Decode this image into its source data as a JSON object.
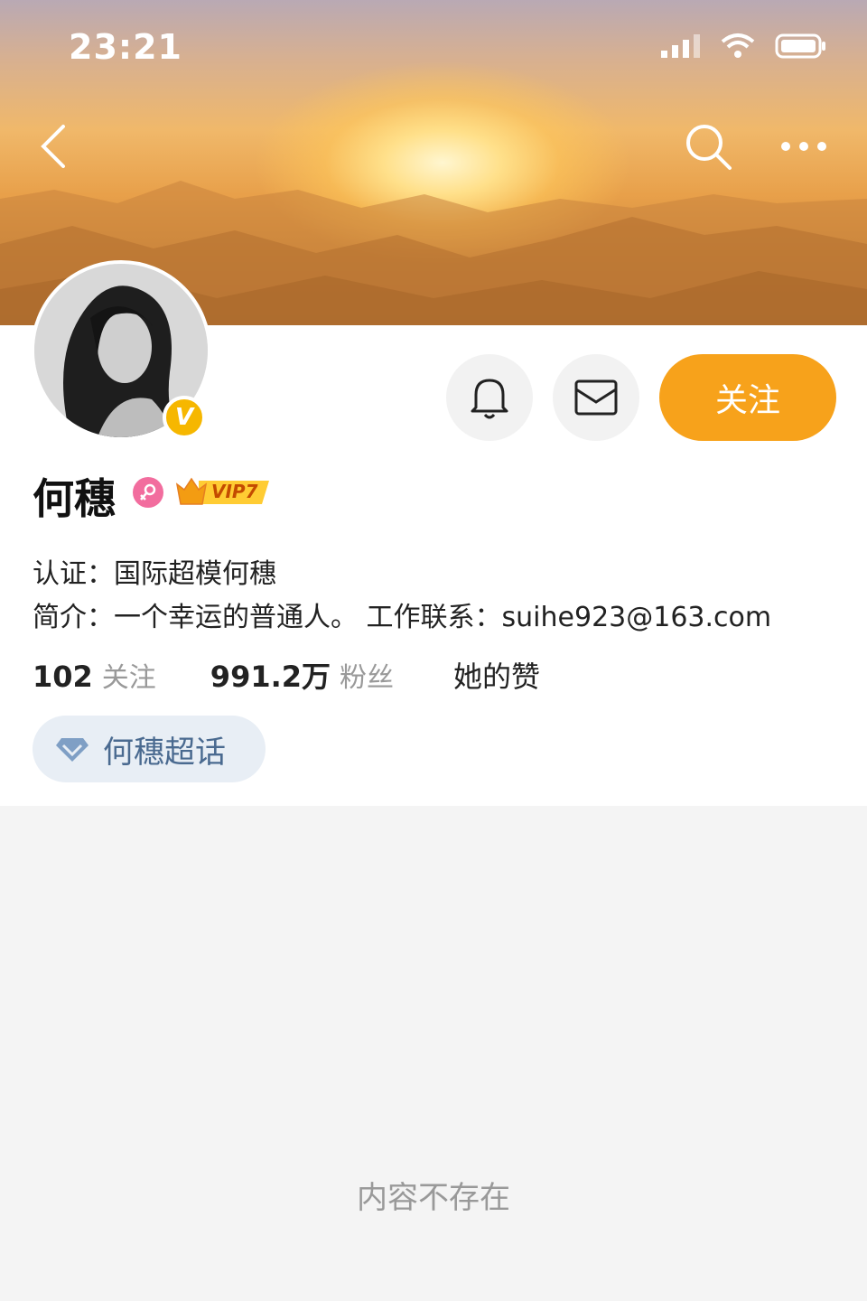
{
  "status_bar": {
    "time": "23:21"
  },
  "profile": {
    "name": "何穗",
    "verified_badge": "V",
    "vip_label": "VIP7",
    "follow_label": "关注",
    "cert_line": "认证：国际超模何穗",
    "bio_line": "简介：一个幸运的普通人。 工作联系：suihe923@163.com",
    "stats": {
      "following_count": "102",
      "following_label": "关注",
      "fans_count": "991.2万",
      "fans_label": "粉丝",
      "likes_label": "她的赞"
    },
    "supertopic_label": "何穗超话"
  },
  "content": {
    "empty_message": "内容不存在"
  },
  "colors": {
    "accent": "#f7a21b",
    "verified": "#f6b700",
    "gender_badge": "#f26d9e",
    "supertopic_text": "#4a6a90"
  },
  "icons": [
    "back-icon",
    "search-icon",
    "more-icon",
    "bell-icon",
    "message-icon",
    "female-icon",
    "crown-icon",
    "diamond-icon",
    "signal-icon",
    "wifi-icon",
    "battery-icon"
  ]
}
